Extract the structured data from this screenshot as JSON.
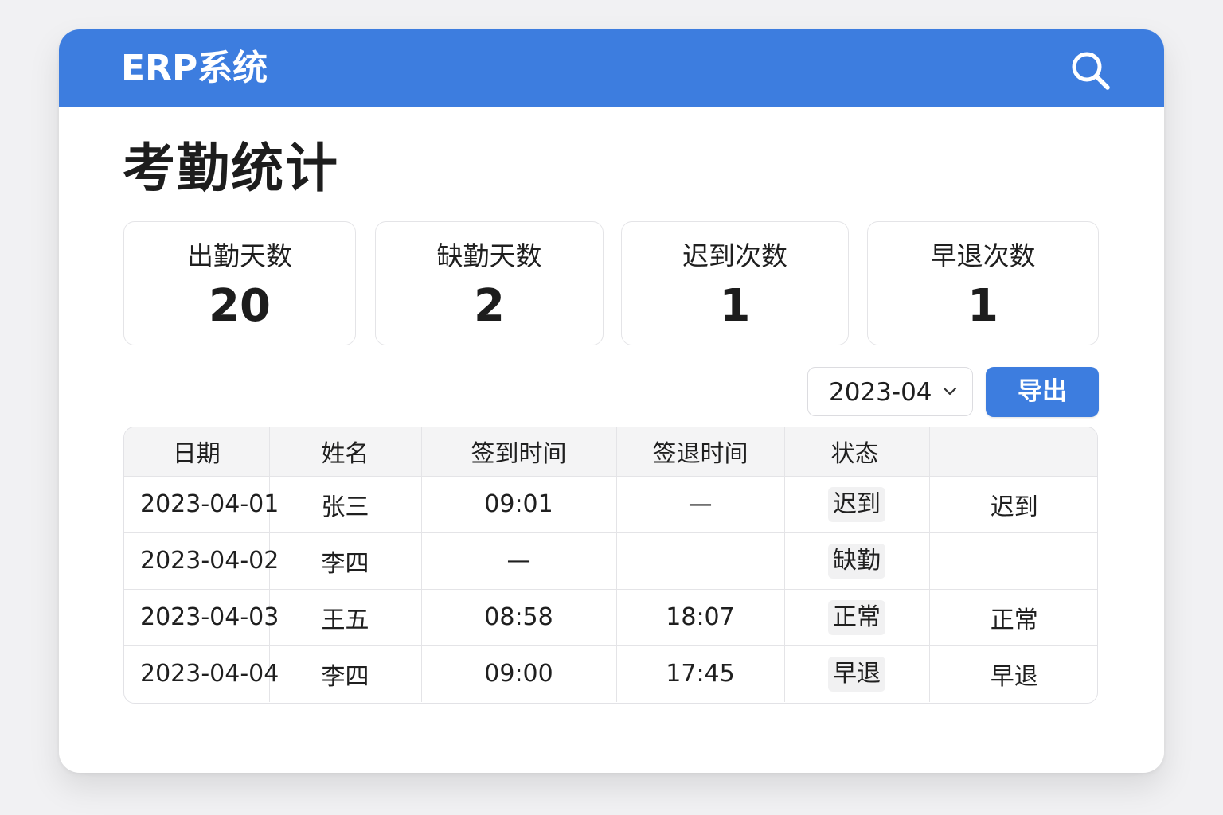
{
  "app": {
    "title": "ERP系统",
    "accent_color": "#3d7ddf",
    "search_icon": "search-icon"
  },
  "page": {
    "title": "考勤统计"
  },
  "stats": [
    {
      "label": "出勤天数",
      "value": "20"
    },
    {
      "label": "缺勤天数",
      "value": "2"
    },
    {
      "label": "迟到次数",
      "value": "1"
    },
    {
      "label": "早退次数",
      "value": "1"
    }
  ],
  "toolbar": {
    "month_value": "2023-04",
    "export_label": "导出"
  },
  "table": {
    "headers": [
      "日期",
      "姓名",
      "签到时间",
      "签退时间",
      "状态",
      ""
    ],
    "rows": [
      {
        "date": "2023-04-01",
        "name": "张三",
        "check_in": "09:01",
        "check_out": "—",
        "status": "迟到",
        "status2": "迟到"
      },
      {
        "date": "2023-04-02",
        "name": "李四",
        "check_in": "—",
        "check_out": "",
        "status": "缺勤",
        "status2": ""
      },
      {
        "date": "2023-04-03",
        "name": "王五",
        "check_in": "08:58",
        "check_out": "18:07",
        "status": "正常",
        "status2": "正常"
      },
      {
        "date": "2023-04-04",
        "name": "李四",
        "check_in": "09:00",
        "check_out": "17:45",
        "status": "早退",
        "status2": "早退"
      }
    ]
  }
}
